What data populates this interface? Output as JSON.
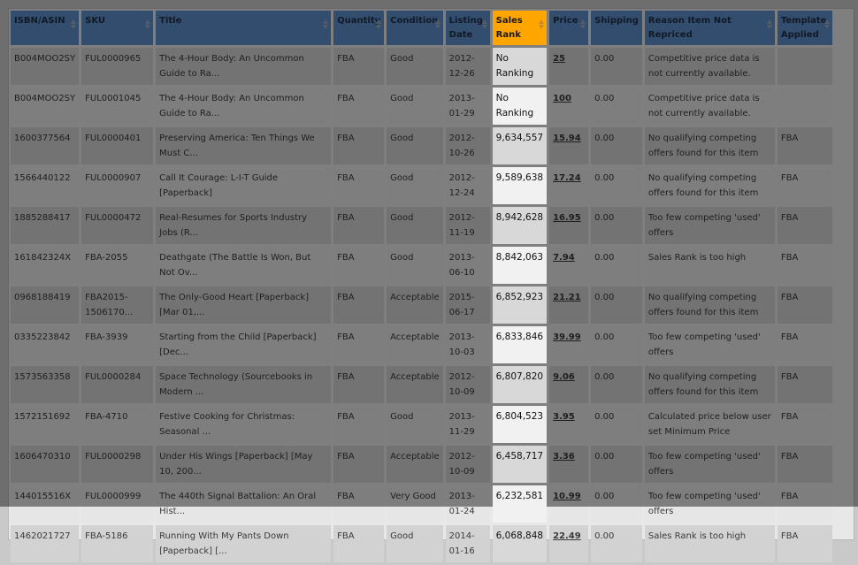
{
  "table": {
    "columns": [
      {
        "key": "isbn",
        "label": "ISBN/ASIN"
      },
      {
        "key": "sku",
        "label": "SKU"
      },
      {
        "key": "title",
        "label": "Title"
      },
      {
        "key": "quantity",
        "label": "Quantity"
      },
      {
        "key": "condition",
        "label": "Condition"
      },
      {
        "key": "listing_date",
        "label": "Listing Date"
      },
      {
        "key": "sales_rank",
        "label": "Sales Rank"
      },
      {
        "key": "price",
        "label": "Price"
      },
      {
        "key": "shipping",
        "label": "Shipping"
      },
      {
        "key": "reason",
        "label": "Reason Item Not Repriced"
      },
      {
        "key": "template",
        "label": "Template Applied"
      }
    ],
    "highlighted_column": "Sales Rank",
    "sorted_column": "Sales Rank",
    "rows": [
      {
        "isbn": "B004MOO2SY",
        "sku": "FUL0000965",
        "title": "The 4-Hour Body: An Uncommon Guide to Ra...",
        "quantity": "FBA",
        "condition": "Good",
        "listing_date": "2012-12-26",
        "sales_rank": "No Ranking",
        "price": "25",
        "shipping": "0.00",
        "reason": "Competitive price data is not currently available.",
        "template": ""
      },
      {
        "isbn": "B004MOO2SY",
        "sku": "FUL0001045",
        "title": "The 4-Hour Body: An Uncommon Guide to Ra...",
        "quantity": "FBA",
        "condition": "Good",
        "listing_date": "2013-01-29",
        "sales_rank": "No Ranking",
        "price": "100",
        "shipping": "0.00",
        "reason": "Competitive price data is not currently available.",
        "template": ""
      },
      {
        "isbn": "1600377564",
        "sku": "FUL0000401",
        "title": "Preserving America: Ten Things We Must C...",
        "quantity": "FBA",
        "condition": "Good",
        "listing_date": "2012-10-26",
        "sales_rank": "9,634,557",
        "price": "15.94",
        "shipping": "0.00",
        "reason": "No qualifying competing offers found for this item",
        "template": "FBA"
      },
      {
        "isbn": "1566440122",
        "sku": "FUL0000907",
        "title": "Call It Courage: L-I-T Guide [Paperback]",
        "quantity": "FBA",
        "condition": "Good",
        "listing_date": "2012-12-24",
        "sales_rank": "9,589,638",
        "price": "17.24",
        "shipping": "0.00",
        "reason": "No qualifying competing offers found for this item",
        "template": "FBA"
      },
      {
        "isbn": "1885288417",
        "sku": "FUL0000472",
        "title": "Real-Resumes for Sports Industry Jobs (R...",
        "quantity": "FBA",
        "condition": "Good",
        "listing_date": "2012-11-19",
        "sales_rank": "8,942,628",
        "price": "16.95",
        "shipping": "0.00",
        "reason": "Too few competing 'used' offers",
        "template": "FBA"
      },
      {
        "isbn": "161842324X",
        "sku": "FBA-2055",
        "title": "Deathgate (The Battle Is Won, But Not Ov...",
        "quantity": "FBA",
        "condition": "Good",
        "listing_date": "2013-06-10",
        "sales_rank": "8,842,063",
        "price": "7.94",
        "shipping": "0.00",
        "reason": "Sales Rank is too high",
        "template": "FBA"
      },
      {
        "isbn": "0968188419",
        "sku": "FBA2015-1506170...",
        "title": "The Only-Good Heart [Paperback] [Mar 01,...",
        "quantity": "FBA",
        "condition": "Acceptable",
        "listing_date": "2015-06-17",
        "sales_rank": "6,852,923",
        "price": "21.21",
        "shipping": "0.00",
        "reason": "No qualifying competing offers found for this item",
        "template": "FBA"
      },
      {
        "isbn": "0335223842",
        "sku": "FBA-3939",
        "title": "Starting from the Child [Paperback] [Dec...",
        "quantity": "FBA",
        "condition": "Acceptable",
        "listing_date": "2013-10-03",
        "sales_rank": "6,833,846",
        "price": "39.99",
        "shipping": "0.00",
        "reason": "Too few competing 'used' offers",
        "template": "FBA"
      },
      {
        "isbn": "1573563358",
        "sku": "FUL0000284",
        "title": "Space Technology (Sourcebooks in Modern ...",
        "quantity": "FBA",
        "condition": "Acceptable",
        "listing_date": "2012-10-09",
        "sales_rank": "6,807,820",
        "price": "9.06",
        "shipping": "0.00",
        "reason": "No qualifying competing offers found for this item",
        "template": "FBA"
      },
      {
        "isbn": "1572151692",
        "sku": "FBA-4710",
        "title": "Festive Cooking for Christmas: Seasonal ...",
        "quantity": "FBA",
        "condition": "Good",
        "listing_date": "2013-11-29",
        "sales_rank": "6,804,523",
        "price": "3.95",
        "shipping": "0.00",
        "reason": "Calculated price below user set Minimum Price",
        "template": "FBA"
      },
      {
        "isbn": "1606470310",
        "sku": "FUL0000298",
        "title": "Under His Wings [Paperback] [May 10, 200...",
        "quantity": "FBA",
        "condition": "Acceptable",
        "listing_date": "2012-10-09",
        "sales_rank": "6,458,717",
        "price": "3.36",
        "shipping": "0.00",
        "reason": "Too few competing 'used' offers",
        "template": "FBA"
      },
      {
        "isbn": "144015516X",
        "sku": "FUL0000999",
        "title": "The 440th Signal Battalion: An Oral Hist...",
        "quantity": "FBA",
        "condition": "Very Good",
        "listing_date": "2013-01-24",
        "sales_rank": "6,232,581",
        "price": "10.99",
        "shipping": "0.00",
        "reason": "Too few competing 'used' offers",
        "template": "FBA"
      },
      {
        "isbn": "1462021727",
        "sku": "FBA-5186",
        "title": "Running With My Pants Down [Paperback] [...",
        "quantity": "FBA",
        "condition": "Good",
        "listing_date": "2014-01-16",
        "sales_rank": "6,068,848",
        "price": "22.49",
        "shipping": "0.00",
        "reason": "Sales Rank is too high",
        "template": "FBA"
      }
    ]
  },
  "colors": {
    "header_bg": "#5c8cc7",
    "highlight_header_bg": "#ffa500",
    "row_odd": "#d2d2d2",
    "row_even": "#e6e6e6"
  }
}
